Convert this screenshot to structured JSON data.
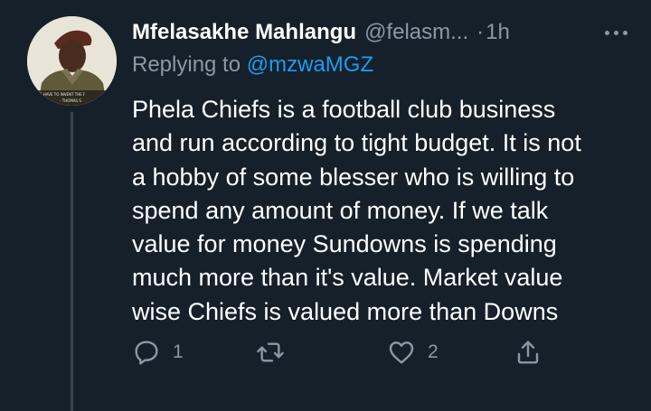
{
  "tweet": {
    "author_name": "Mfelasakhe Mahlangu",
    "author_handle": "@felasm...",
    "separator": "·",
    "time": "1h",
    "replying_prefix": "Replying to ",
    "replying_to": "@mzwaMGZ",
    "body_lines": [
      "Phela Chiefs is a football club business",
      "and run according to tight budget. It is not",
      "a hobby of some blesser who is willing to",
      "spend any amount of money. If we talk",
      "value for money Sundowns is spending",
      "much more than it's value. Market value",
      "wise Chiefs is valued more than Downs"
    ],
    "avatar_caption_line1": "WE HAVE TO INVENT THE F",
    "avatar_caption_line2": "- THOMAS S"
  },
  "actions": {
    "reply_count": "1",
    "retweet_count": "",
    "like_count": "2"
  },
  "icons": {
    "reply": "reply-icon",
    "retweet": "retweet-icon",
    "like": "heart-icon",
    "share": "share-icon",
    "more": "more-icon"
  },
  "colors": {
    "background": "#15202b",
    "primary_text": "#ffffff",
    "secondary_text": "#8b98a5",
    "link": "#1d9bf0",
    "thread_line": "#38444d"
  }
}
